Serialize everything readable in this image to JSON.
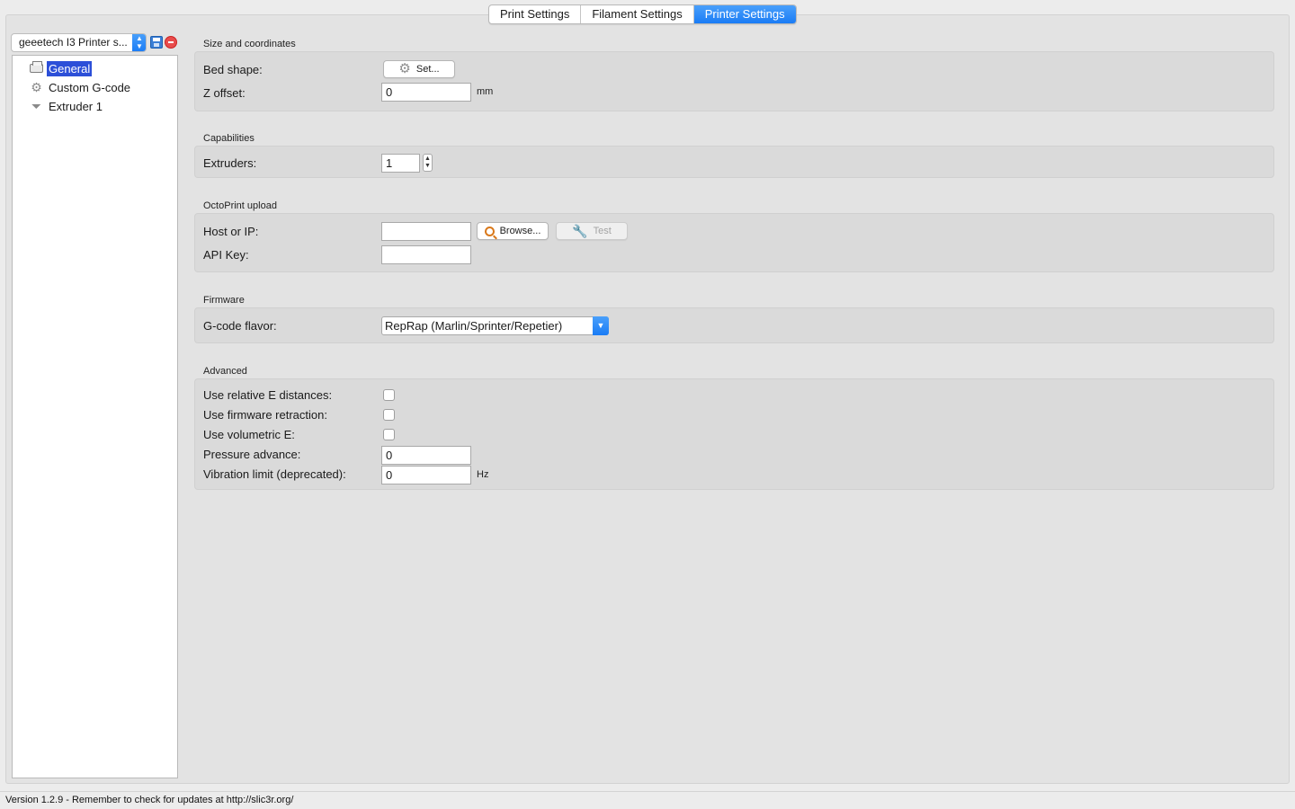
{
  "tabs": [
    {
      "label": "Print Settings",
      "active": false
    },
    {
      "label": "Filament Settings",
      "active": false
    },
    {
      "label": "Printer Settings",
      "active": true
    }
  ],
  "preset": {
    "value": "geeetech I3 Printer s..."
  },
  "tree": {
    "items": [
      {
        "label": "General",
        "icon": "printer-icon",
        "selected": true
      },
      {
        "label": "Custom G-code",
        "icon": "gear-icon",
        "selected": false
      },
      {
        "label": "Extruder 1",
        "icon": "funnel-icon",
        "selected": false
      }
    ]
  },
  "size_coords": {
    "title": "Size and coordinates",
    "bed_shape_label": "Bed shape:",
    "bed_shape_button": "Set...",
    "z_offset_label": "Z offset:",
    "z_offset_value": "0",
    "z_offset_unit": "mm"
  },
  "capabilities": {
    "title": "Capabilities",
    "extruders_label": "Extruders:",
    "extruders_value": "1"
  },
  "octoprint": {
    "title": "OctoPrint upload",
    "host_label": "Host or IP:",
    "host_value": "",
    "browse_button": "Browse...",
    "test_button": "Test",
    "api_key_label": "API Key:",
    "api_key_value": ""
  },
  "firmware": {
    "title": "Firmware",
    "gcode_flavor_label": "G-code flavor:",
    "gcode_flavor_value": "RepRap (Marlin/Sprinter/Repetier)"
  },
  "advanced": {
    "title": "Advanced",
    "relative_e_label": "Use relative E distances:",
    "relative_e_checked": false,
    "firmware_retraction_label": "Use firmware retraction:",
    "firmware_retraction_checked": false,
    "volumetric_e_label": "Use volumetric E:",
    "volumetric_e_checked": false,
    "pressure_advance_label": "Pressure advance:",
    "pressure_advance_value": "0",
    "vibration_limit_label": "Vibration limit (deprecated):",
    "vibration_limit_value": "0",
    "vibration_limit_unit": "Hz"
  },
  "status": {
    "text": "Version 1.2.9 - Remember to check for updates at http://slic3r.org/"
  },
  "colors": {
    "accent": "#1a7cf5",
    "selection": "#2c4fd8",
    "panel": "#dadada"
  }
}
